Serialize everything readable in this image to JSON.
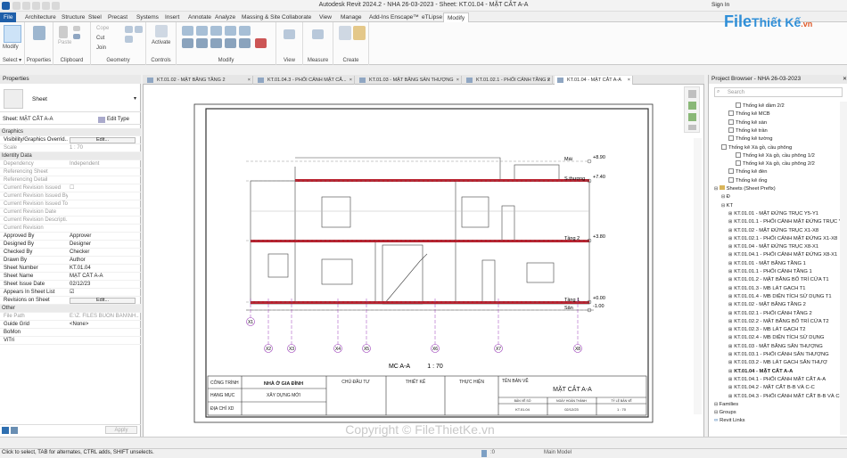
{
  "window": {
    "title": "Autodesk Revit 2024.2 - NHA 26-03-2023 - Sheet: KT.01.04 - MẶT CẮT A-A",
    "sign_in": "Sign In"
  },
  "ribbon_tabs": [
    "File",
    "Architecture",
    "Structure",
    "Steel",
    "Precast",
    "Systems",
    "Insert",
    "Annotate",
    "Analyze",
    "Massing & Site",
    "Collaborate",
    "View",
    "Manage",
    "Add-Ins",
    "Enscape™",
    "eTLipse",
    "Modify"
  ],
  "ribbon": {
    "modify": "Modify",
    "select": "Select ▾",
    "properties": "Properties",
    "clipboard": "Clipboard",
    "paste": "Paste",
    "cope": "Cope",
    "cut": "Cut",
    "join": "Join",
    "geometry": "Geometry",
    "activate": "Activate",
    "controls": "Controls",
    "modify_group": "Modify",
    "view": "View",
    "measure": "Measure",
    "create": "Create"
  },
  "properties_panel": {
    "title": "Properties",
    "type": "Sheet",
    "instance": "Sheet: MẶT CẮT A-A",
    "edit_type": "Edit Type",
    "rows": [
      {
        "k": "Graphics",
        "v": "",
        "cat": true
      },
      {
        "k": "Visibility/Graphics Overrid...",
        "v": "",
        "btn": "Edit..."
      },
      {
        "k": "Scale",
        "v": "1 : 70",
        "grey": true
      },
      {
        "k": "Identity Data",
        "v": "",
        "cat": true
      },
      {
        "k": "Dependency",
        "v": "Independent",
        "grey": true
      },
      {
        "k": "Referencing Sheet",
        "v": "",
        "grey": true
      },
      {
        "k": "Referencing Detail",
        "v": "",
        "grey": true
      },
      {
        "k": "Current Revision Issued",
        "v": "☐",
        "grey": true
      },
      {
        "k": "Current Revision Issued By",
        "v": "",
        "grey": true
      },
      {
        "k": "Current Revision Issued To",
        "v": "",
        "grey": true
      },
      {
        "k": "Current Revision Date",
        "v": "",
        "grey": true
      },
      {
        "k": "Current Revision Descripti...",
        "v": "",
        "grey": true
      },
      {
        "k": "Current Revision",
        "v": "",
        "grey": true
      },
      {
        "k": "Approved By",
        "v": "Approver"
      },
      {
        "k": "Designed By",
        "v": "Designer"
      },
      {
        "k": "Checked By",
        "v": "Checker"
      },
      {
        "k": "Drawn By",
        "v": "Author"
      },
      {
        "k": "Sheet Number",
        "v": "KT.01.04"
      },
      {
        "k": "Sheet Name",
        "v": "MẶT CẮT A-A"
      },
      {
        "k": "Sheet Issue Date",
        "v": "02/12/23"
      },
      {
        "k": "Appears In Sheet List",
        "v": "☑"
      },
      {
        "k": "Revisions on Sheet",
        "v": "",
        "btn": "Edit..."
      },
      {
        "k": "Other",
        "v": "",
        "cat": true
      },
      {
        "k": "File Path",
        "v": "E:\\Z. FILES BUON BAN\\NH...",
        "grey": true
      },
      {
        "k": "Guide Grid",
        "v": "<None>"
      },
      {
        "k": "BoMon",
        "v": ""
      },
      {
        "k": "ViTri",
        "v": ""
      }
    ],
    "apply": "Apply"
  },
  "view_tabs": [
    "KT.01.02 - MẶT BẰNG TẦNG 2",
    "KT.01.04.3 - PHỐI CẢNH MẶT CẮ...",
    "KT.01.03 - MẶT BẰNG SÂN THƯỢNG",
    "KT.01.02.1 - PHỐI CẢNH TẦNG 2",
    "KT.01.04 - MẶT CẮT A-A"
  ],
  "drawing": {
    "levels": [
      {
        "name": "Mái",
        "elev": "+8.90"
      },
      {
        "name": "S.thượng",
        "elev": "+7.40"
      },
      {
        "name": "Tầng 2",
        "elev": "+3.80"
      },
      {
        "name": "Tầng 1",
        "elev": "+0.00"
      },
      {
        "name": "Sân",
        "elev": "-1.00"
      }
    ],
    "grids": [
      "X1",
      "X2",
      "X3",
      "X4",
      "X5",
      "X6",
      "X7",
      "X8"
    ],
    "view_title": "MC A-A",
    "view_scale": "1 : 70",
    "titleblock": {
      "cong_trinh_label": "CÔNG TRÌNH",
      "cong_trinh": "NHÀ Ở GIA ĐÌNH",
      "hang_muc_label": "HẠNG MỤC",
      "hang_muc": "XÂY DỰNG MỚI",
      "dia_chi_label": "ĐỊA CHỈ XD",
      "chu_dau_tu": "CHỦ ĐẦU TƯ",
      "thiet_ke": "THIẾT KẾ",
      "thuc_hien": "THỰC HIỆN",
      "ten_ban_ve_label": "TÊN BẢN VẼ",
      "ten_ban_ve": "MẶT CẮT A-A",
      "so_hieu_label": "BẢN VẼ SỐ",
      "ngay_label": "NGÀY HOÀN THÀNH",
      "ty_le_label": "TỶ LỆ BẢN VẼ",
      "so_hieu": "KT.01.04",
      "ngay": "02/12/23",
      "ty_le": "1 : 70"
    }
  },
  "browser": {
    "title": "Project Browser - NHA 26-03-2023",
    "search": "Search",
    "items": [
      {
        "t": "Thống kê dầm 2/2",
        "i": 3,
        "s": "sched"
      },
      {
        "t": "Thống kê MCB",
        "i": 2,
        "s": "sched"
      },
      {
        "t": "Thống kê sàn",
        "i": 2,
        "s": "sched"
      },
      {
        "t": "Thống kê trần",
        "i": 2,
        "s": "sched"
      },
      {
        "t": "Thống kê tường",
        "i": 2,
        "s": "sched"
      },
      {
        "t": "Thống kê Xà gồ, cầu phông",
        "i": 1,
        "s": "sched"
      },
      {
        "t": "Thống kê Xà gồ, cầu phông 1/2",
        "i": 3,
        "s": "sched"
      },
      {
        "t": "Thống kê Xà gồ, cầu phông 2/2",
        "i": 3,
        "s": "sched"
      },
      {
        "t": "Thống kê đèn",
        "i": 2,
        "s": "sched"
      },
      {
        "t": "Thống kê ống",
        "i": 2,
        "s": "sched"
      },
      {
        "t": "Sheets (Sheet Prefix)",
        "i": 0,
        "s": "folder"
      },
      {
        "t": "Đ",
        "i": 1,
        "s": "tree"
      },
      {
        "t": "KT",
        "i": 1,
        "s": "tree"
      },
      {
        "t": "KT.01.01 - MẶT ĐỨNG TRỤC Y5-Y1",
        "i": 2,
        "s": "sheet"
      },
      {
        "t": "KT.01.01.1 - PHỐI CẢNH MẶT ĐỨNG TRỤC Y",
        "i": 2,
        "s": "sheet"
      },
      {
        "t": "KT.01.02 - MẶT ĐỨNG TRỤC X1-X8",
        "i": 2,
        "s": "sheet"
      },
      {
        "t": "KT.01.02.1 - PHỐI CẢNH MẶT ĐỨNG X1-X8",
        "i": 2,
        "s": "sheet"
      },
      {
        "t": "KT.01.04 - MẶT ĐỨNG TRỤC X8-X1",
        "i": 2,
        "s": "sheet"
      },
      {
        "t": "KT.01.04.1 - PHỐI CẢNH MẶT ĐỨNG X8-X1",
        "i": 2,
        "s": "sheet"
      },
      {
        "t": "KT.01.01 - MẶT BẰNG TẦNG 1",
        "i": 2,
        "s": "sheet"
      },
      {
        "t": "KT.01.01.1 - PHỐI CẢNH TẦNG 1",
        "i": 2,
        "s": "sheet"
      },
      {
        "t": "KT.01.01.2 - MẶT BẰNG BỐ TRÍ CỬA T1",
        "i": 2,
        "s": "sheet"
      },
      {
        "t": "KT.01.01.3 - MB LÁT GẠCH T1",
        "i": 2,
        "s": "sheet"
      },
      {
        "t": "KT.01.01.4 - MB DIỆN TÍCH SỬ DỤNG T1",
        "i": 2,
        "s": "sheet"
      },
      {
        "t": "KT.01.02 - MẶT BẰNG TẦNG 2",
        "i": 2,
        "s": "sheet"
      },
      {
        "t": "KT.01.02.1 - PHỐI CẢNH TẦNG 2",
        "i": 2,
        "s": "sheet"
      },
      {
        "t": "KT.01.02.2 - MẶT BẰNG BỐ TRÍ CỬA T2",
        "i": 2,
        "s": "sheet"
      },
      {
        "t": "KT.01.02.3 - MB LÁT GẠCH T2",
        "i": 2,
        "s": "sheet"
      },
      {
        "t": "KT.01.02.4 - MB DIỆN TÍCH SỬ DỤNG",
        "i": 2,
        "s": "sheet"
      },
      {
        "t": "KT.01.03 - MẶT BẰNG SÂN THƯỢNG",
        "i": 2,
        "s": "sheet"
      },
      {
        "t": "KT.01.03.1 - PHỐI CẢNH SÂN THƯỢNG",
        "i": 2,
        "s": "sheet"
      },
      {
        "t": "KT.01.03.2 - MB LÁT GẠCH SÂN THƯỢ",
        "i": 2,
        "s": "sheet"
      },
      {
        "t": "KT.01.04 - MẶT CẮT A-A",
        "i": 2,
        "s": "sheet",
        "bold": true
      },
      {
        "t": "KT.01.04.1 - PHỐI CẢNH MẶT CẮT A-A",
        "i": 2,
        "s": "sheet"
      },
      {
        "t": "KT.01.04.2 - MẶT CẮT B-B VÀ C-C",
        "i": 2,
        "s": "sheet"
      },
      {
        "t": "KT.01.04.3 - PHỐI CẢNH MẶT CẮT B-B VÀ C-",
        "i": 2,
        "s": "sheet"
      },
      {
        "t": "Families",
        "i": 0,
        "s": "tree"
      },
      {
        "t": "Groups",
        "i": 0,
        "s": "tree"
      },
      {
        "t": "Revit Links",
        "i": 0,
        "s": "link"
      }
    ]
  },
  "watermark": {
    "logo_main": "File",
    "logo_rest": "Thiết Kế",
    "logo_tld": ".vn",
    "copyright": "Copyright © FileThietKe.vn"
  },
  "status": {
    "message": "Click to select, TAB for alternates, CTRL adds, SHIFT unselects.",
    "model": "Main Model",
    "zero": ":0"
  }
}
